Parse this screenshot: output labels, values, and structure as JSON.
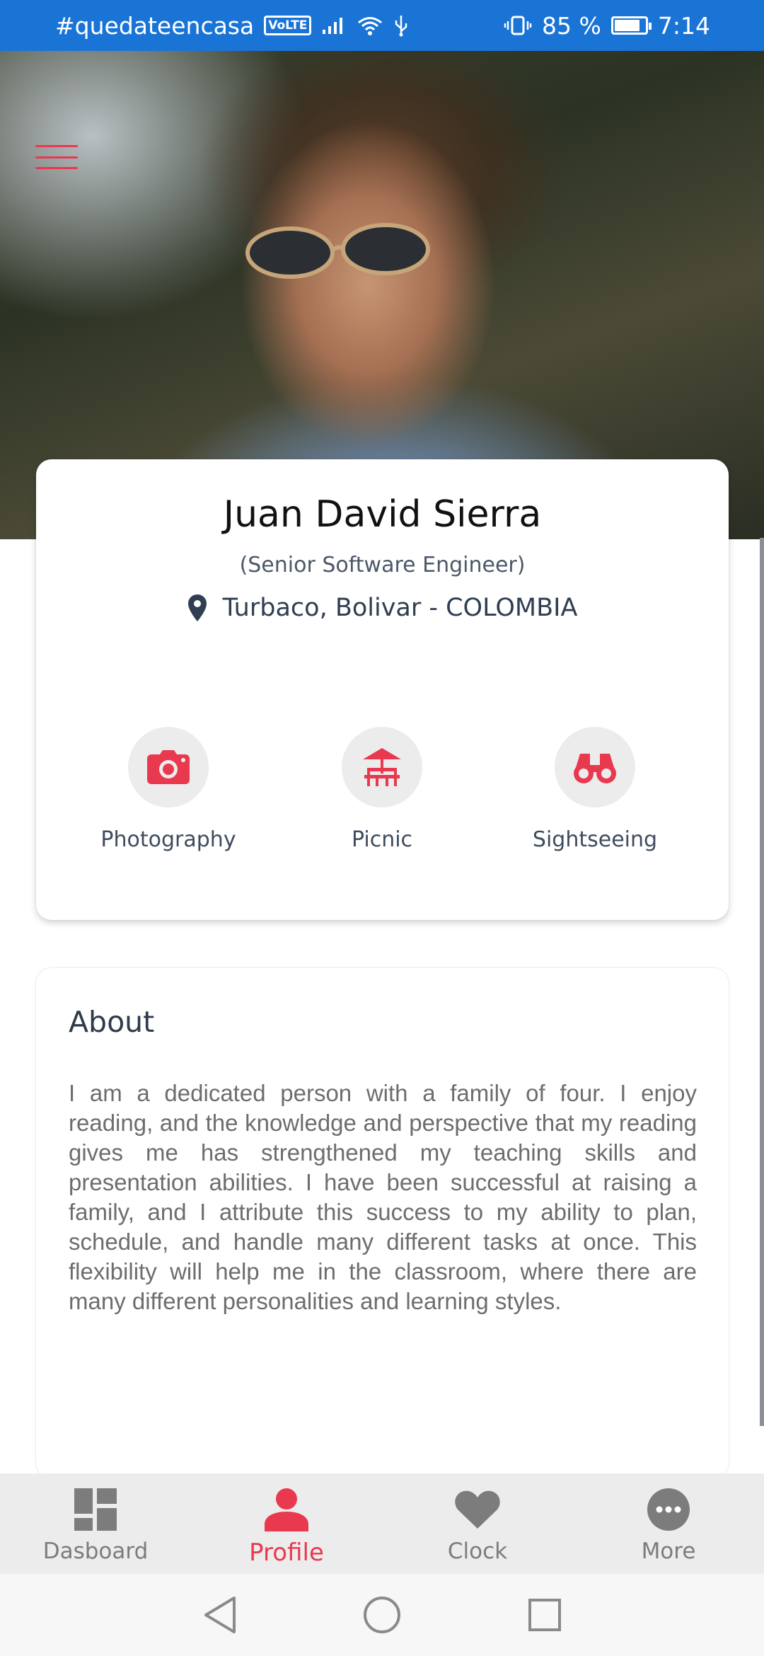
{
  "status_bar": {
    "carrier_tag": "#quedateencasa",
    "volte": "VoLTE",
    "battery_percent": "85 %",
    "battery_level": 0.85,
    "time": "7:14"
  },
  "profile": {
    "name": "Juan David Sierra",
    "role": "(Senior Software Engineer)",
    "location": "Turbaco, Bolivar - COLOMBIA"
  },
  "interests": [
    {
      "label": "Photography",
      "icon": "camera-icon"
    },
    {
      "label": "Picnic",
      "icon": "picnic-icon"
    },
    {
      "label": "Sightseeing",
      "icon": "binoculars-icon"
    }
  ],
  "about": {
    "title": "About",
    "text": "I am a dedicated person with a family of four. I enjoy reading, and the knowledge and perspective that my reading gives me has strengthened my teaching skills and presentation abilities. I have been successful at raising a family, and I attribute this success to my ability to plan, schedule, and handle many different tasks at once. This flexibility will help me in the classroom, where there are many different personalities and learning styles."
  },
  "tabs": [
    {
      "label": "Dasboard",
      "icon": "dashboard-icon",
      "active": false
    },
    {
      "label": "Profile",
      "icon": "person-icon",
      "active": true
    },
    {
      "label": "Clock",
      "icon": "heart-icon",
      "active": false
    },
    {
      "label": "More",
      "icon": "more-icon",
      "active": false
    }
  ],
  "colors": {
    "accent": "#e8394f",
    "status_bar": "#1a74d6",
    "tab_inactive": "#7c7c7c"
  }
}
